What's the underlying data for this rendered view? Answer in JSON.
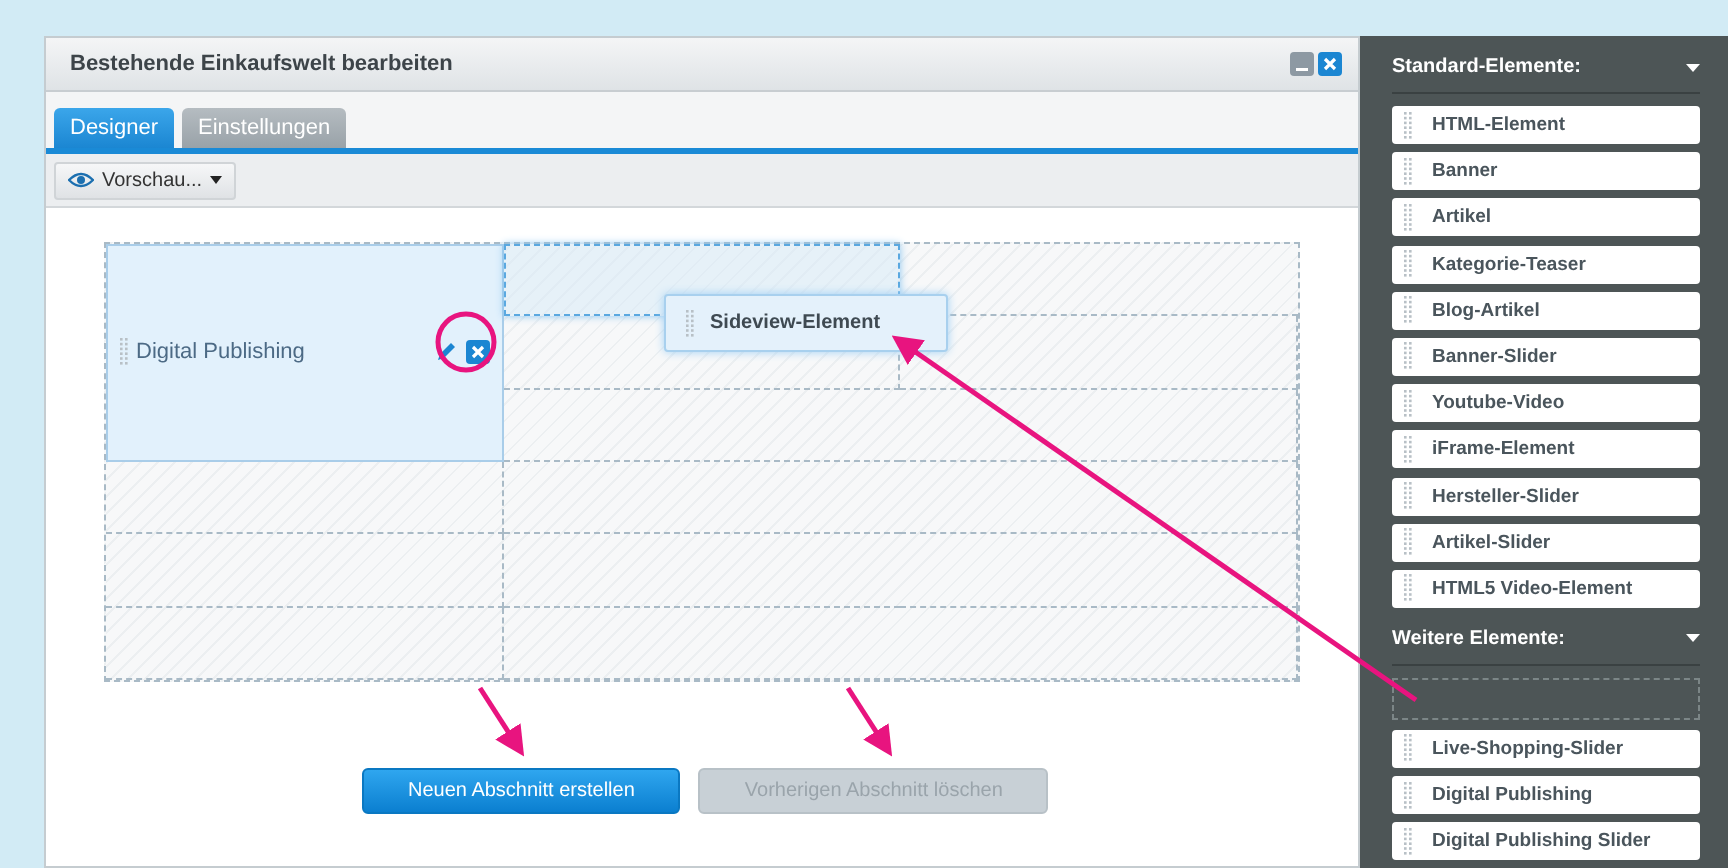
{
  "window": {
    "title": "Bestehende Einkaufswelt bearbeiten"
  },
  "tabs": [
    {
      "label": "Designer",
      "selected": true
    },
    {
      "label": "Einstellungen",
      "selected": false
    }
  ],
  "toolbar": {
    "preview_button": "Vorschau..."
  },
  "grid": {
    "blocks": [
      {
        "label": "Digital Publishing"
      }
    ],
    "dragged_element": "Sideview-Element"
  },
  "buttons": [
    {
      "label": "Neuen Abschnitt erstellen",
      "disabled": false
    },
    {
      "label": "Vorherigen Abschnitt löschen",
      "disabled": true
    }
  ],
  "sidebar": {
    "sections": [
      {
        "title": "Standard-Elemente:",
        "items": [
          "HTML-Element",
          "Banner",
          "Artikel",
          "Kategorie-Teaser",
          "Blog-Artikel",
          "Banner-Slider",
          "Youtube-Video",
          "iFrame-Element",
          "Hersteller-Slider",
          "Artikel-Slider",
          "HTML5 Video-Element"
        ]
      },
      {
        "title": "Weitere Elemente:",
        "drop_zone": true,
        "items": [
          "Live-Shopping-Slider",
          "Digital Publishing",
          "Digital Publishing Slider"
        ]
      }
    ]
  }
}
